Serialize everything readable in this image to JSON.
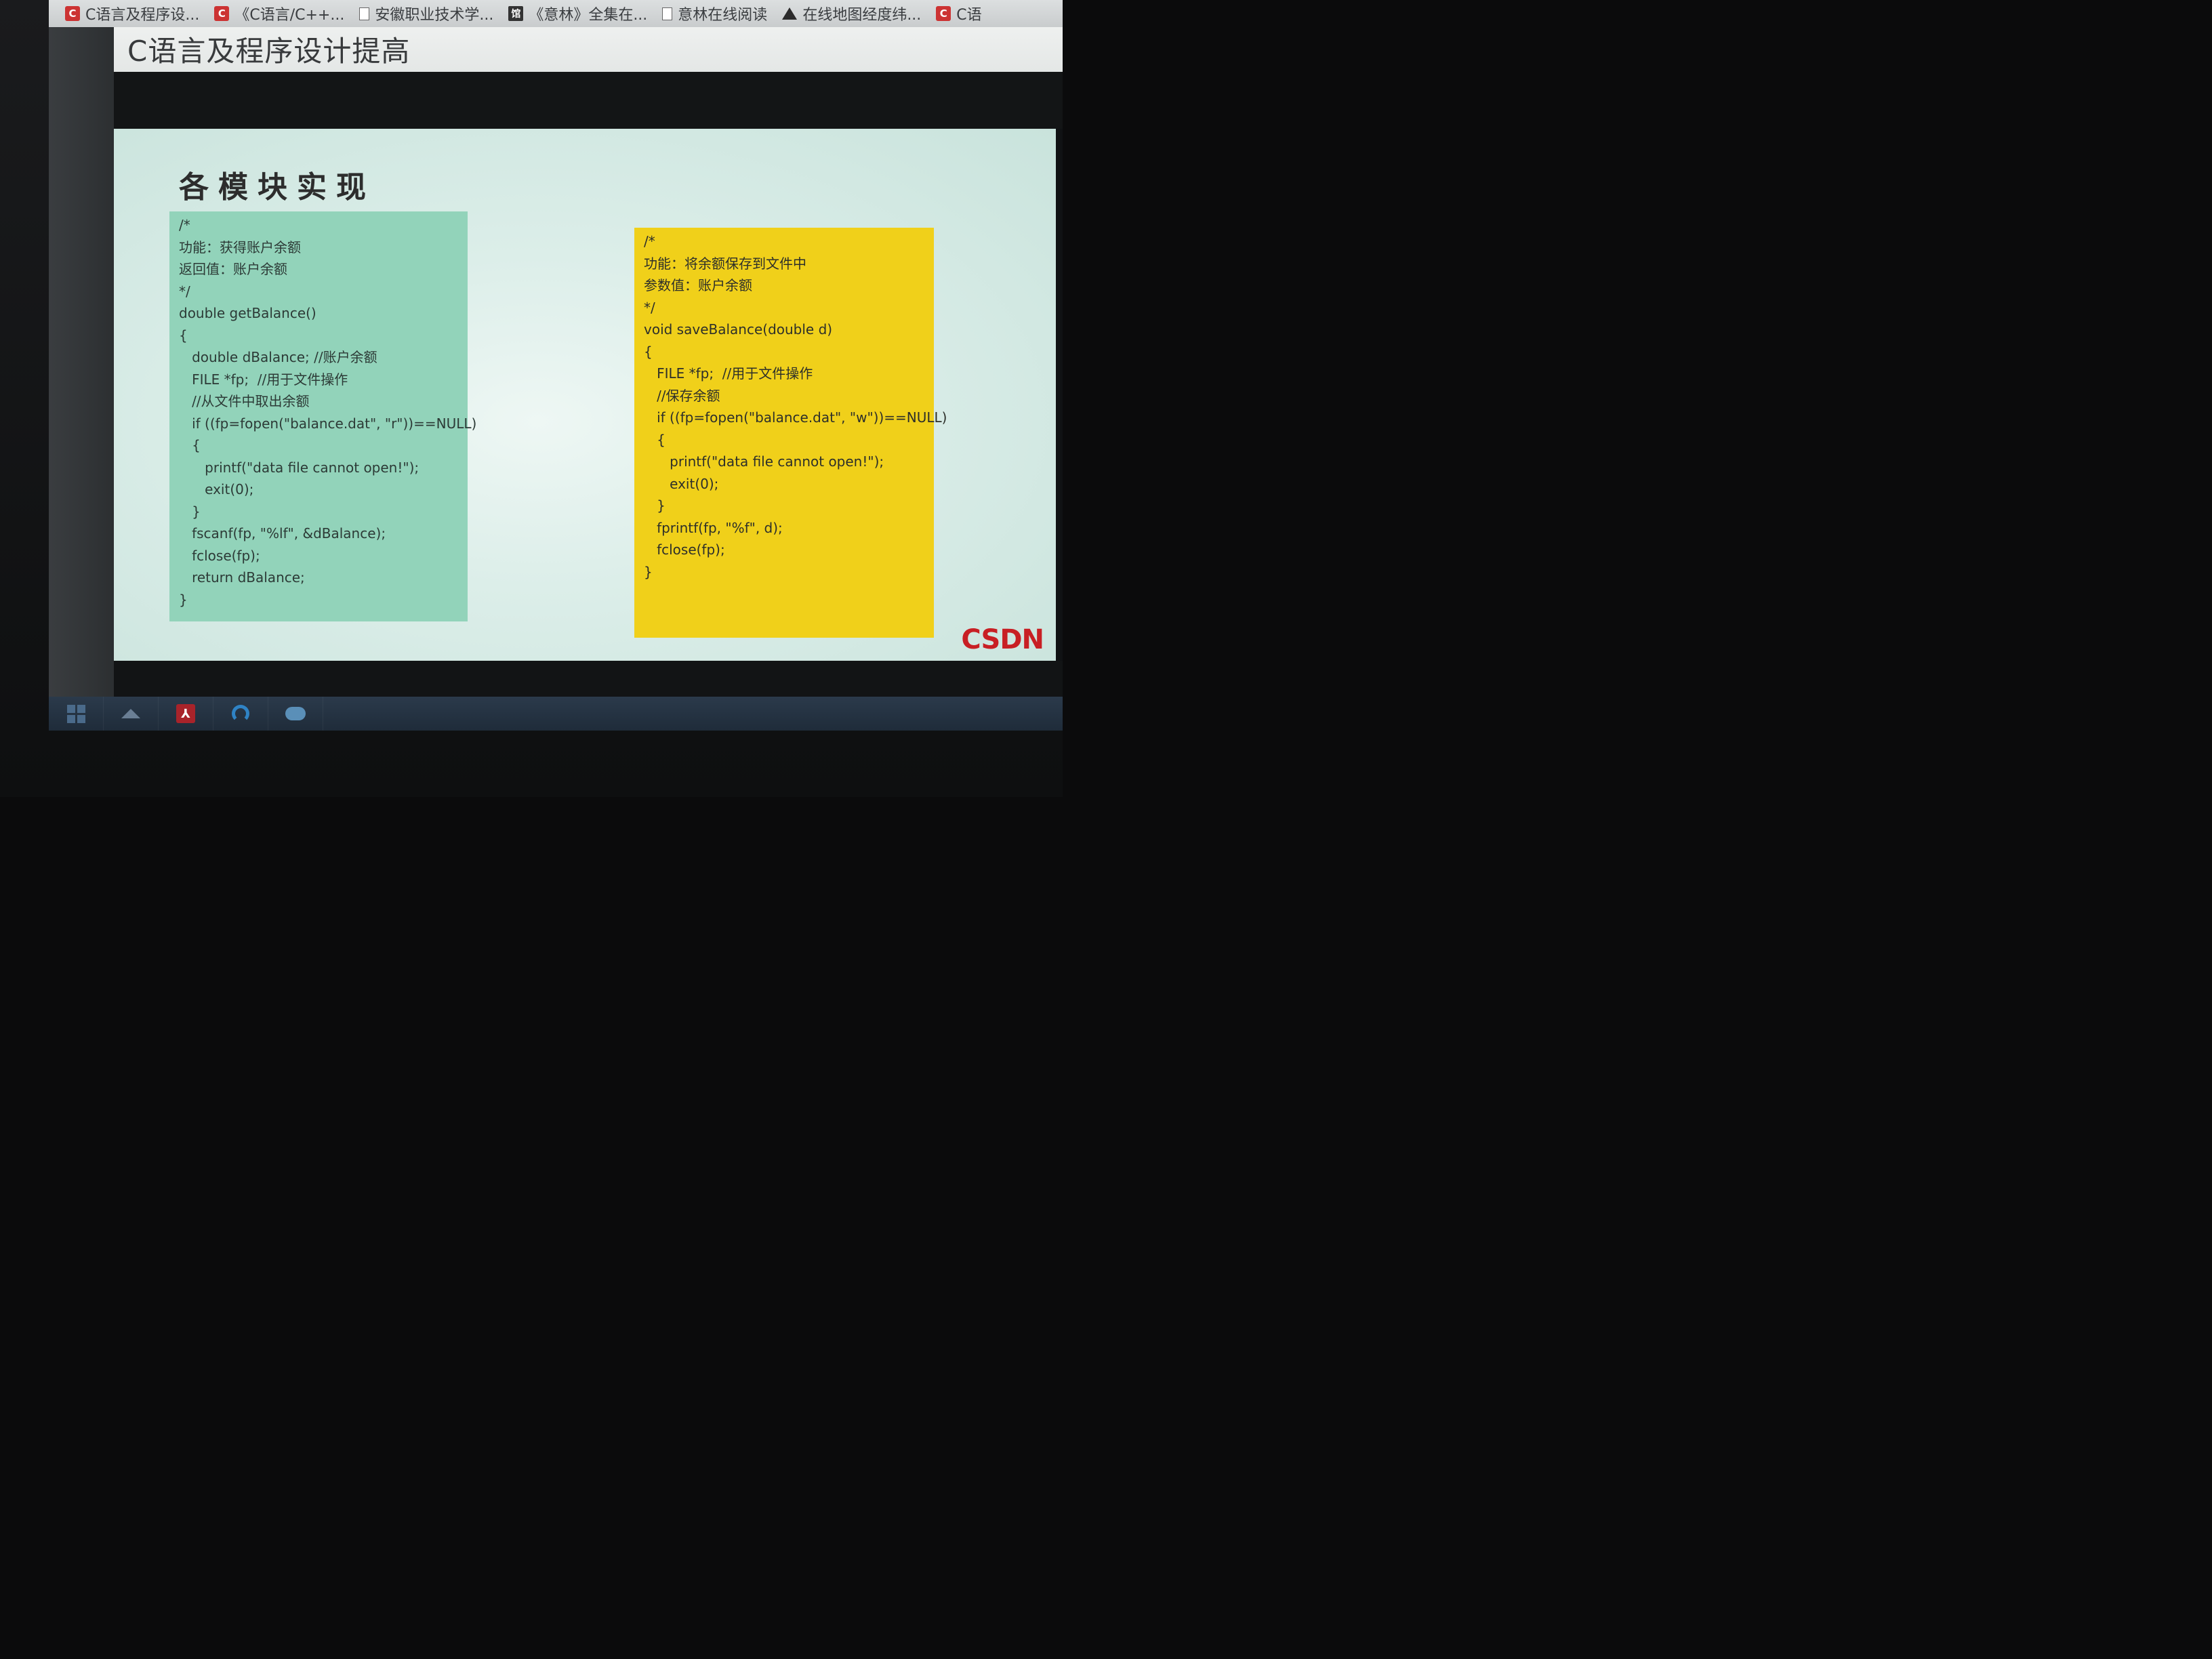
{
  "bookmarks": [
    {
      "icon": "csdn-icon",
      "label": "C语言及程序设..."
    },
    {
      "icon": "csdn-icon",
      "label": "《C语言/C++..."
    },
    {
      "icon": "page-icon",
      "label": "安徽职业技术学..."
    },
    {
      "icon": "guan-icon",
      "label": "《意林》全集在..."
    },
    {
      "icon": "page-icon",
      "label": "意林在线阅读"
    },
    {
      "icon": "map-icon",
      "label": "在线地图经度纬..."
    },
    {
      "icon": "csdn-icon",
      "label": "C语"
    }
  ],
  "page": {
    "title": "C语言及程序设计提高"
  },
  "slide": {
    "title": "各模块实现",
    "logo": "CSDN",
    "left_code": {
      "lines": [
        "/*",
        "功能：获得账户余额",
        "返回值：账户余额",
        "*/",
        "double getBalance()",
        "{",
        "   double dBalance; //账户余额",
        "   FILE *fp;  //用于文件操作",
        "   //从文件中取出余额",
        "   if ((fp=fopen(\"balance.dat\", \"r\"))==NULL)",
        "   {",
        "      printf(\"data file cannot open!\");",
        "      exit(0);",
        "   }",
        "   fscanf(fp, \"%lf\", &dBalance);",
        "   fclose(fp);",
        "   return dBalance;",
        "}"
      ]
    },
    "right_code": {
      "lines": [
        "/*",
        "功能：将余额保存到文件中",
        "参数值：账户余额",
        "*/",
        "void saveBalance(double d)",
        "{",
        "   FILE *fp;  //用于文件操作",
        "   //保存余额",
        "   if ((fp=fopen(\"balance.dat\", \"w\"))==NULL)",
        "   {",
        "      printf(\"data file cannot open!\");",
        "      exit(0);",
        "   }",
        "   fprintf(fp, \"%f\", d);",
        "   fclose(fp);",
        "}"
      ]
    }
  },
  "taskbar": {
    "items": [
      "windows-start-icon",
      "home-icon",
      "pdf-reader-icon",
      "browser-icon",
      "cloud-app-icon"
    ]
  },
  "colors": {
    "left_box": "#92d3ba",
    "right_box": "#f0d01a",
    "annotation": "#c8282a",
    "csdn_logo": "#c81f24"
  }
}
